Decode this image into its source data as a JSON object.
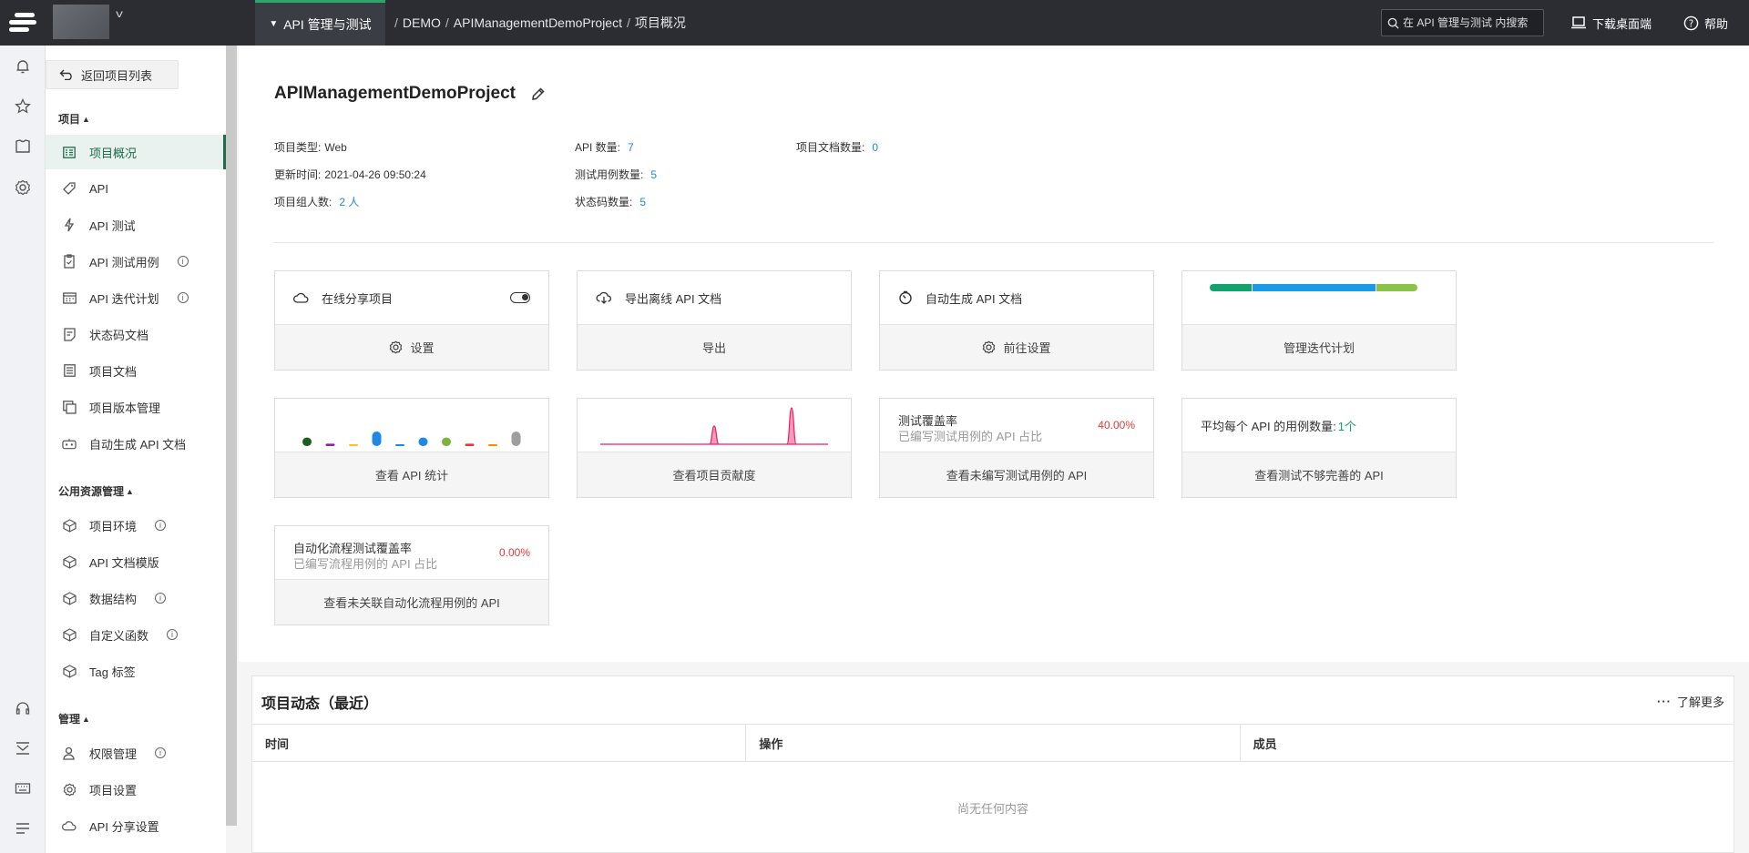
{
  "header": {
    "service_tab": "API 管理与测试",
    "breadcrumb": [
      "DEMO",
      "APIManagementDemoProject",
      "项目概况"
    ],
    "search_placeholder": "在 API 管理与测试 内搜索",
    "download_label": "下载桌面端",
    "help_label": "帮助"
  },
  "sidebar": {
    "back_label": "返回项目列表",
    "groups": [
      {
        "label": "项目",
        "items": [
          {
            "label": "项目概况",
            "icon": "overview-icon",
            "active": true,
            "info": false
          },
          {
            "label": "API",
            "icon": "api-tag-icon",
            "info": false
          },
          {
            "label": "API 测试",
            "icon": "lightning-icon",
            "info": false
          },
          {
            "label": "API 测试用例",
            "icon": "clipboard-icon",
            "info": true
          },
          {
            "label": "API 迭代计划",
            "icon": "calendar-icon",
            "info": true
          },
          {
            "label": "状态码文档",
            "icon": "status-doc-icon",
            "info": false
          },
          {
            "label": "项目文档",
            "icon": "doc-icon",
            "info": false
          },
          {
            "label": "项目版本管理",
            "icon": "versions-icon",
            "info": false
          },
          {
            "label": "自动生成 API 文档",
            "icon": "robot-icon",
            "info": false
          }
        ]
      },
      {
        "label": "公用资源管理",
        "items": [
          {
            "label": "项目环境",
            "icon": "cube-icon",
            "info": true
          },
          {
            "label": "API 文档模版",
            "icon": "cube-icon",
            "info": false
          },
          {
            "label": "数据结构",
            "icon": "cube-icon",
            "info": true
          },
          {
            "label": "自定义函数",
            "icon": "cube-icon",
            "info": true
          },
          {
            "label": "Tag 标签",
            "icon": "cube-icon",
            "info": false
          }
        ]
      },
      {
        "label": "管理",
        "items": [
          {
            "label": "权限管理",
            "icon": "user-lock-icon",
            "info": true
          },
          {
            "label": "项目设置",
            "icon": "gear-icon",
            "info": false
          },
          {
            "label": "API 分享设置",
            "icon": "cloud-icon",
            "info": false
          }
        ]
      }
    ]
  },
  "project": {
    "name": "APIManagementDemoProject",
    "type_label": "项目类型:",
    "type_value": "Web",
    "updated_label": "更新时间:",
    "updated_value": "2021-04-26 09:50:24",
    "members_label": "项目组人数:",
    "members_value": "2 人",
    "api_count_label": "API 数量:",
    "api_count_value": "7",
    "case_count_label": "测试用例数量:",
    "case_count_value": "5",
    "status_count_label": "状态码数量:",
    "status_count_value": "5",
    "doc_count_label": "项目文档数量:",
    "doc_count_value": "0"
  },
  "cards": {
    "share": {
      "title": "在线分享项目",
      "action": "设置"
    },
    "export": {
      "title": "导出离线 API 文档",
      "action": "导出"
    },
    "autogen": {
      "title": "自动生成 API 文档",
      "action": "前往设置"
    },
    "iteration": {
      "action": "管理迭代计划",
      "segments": [
        {
          "value": 20,
          "color": "#13a26b"
        },
        {
          "value": 60,
          "color": "#1b9ae8"
        },
        {
          "value": 20,
          "color": "#8bc34a"
        }
      ]
    },
    "api_stats": {
      "action": "查看 API 统计"
    },
    "contribution": {
      "action": "查看项目贡献度"
    },
    "test_coverage": {
      "title": "测试覆盖率",
      "subtitle": "已编写测试用例的 API 占比",
      "percent": "40.00%",
      "action": "查看未编写测试用例的 API"
    },
    "avg_cases": {
      "label": "平均每个 API 的用例数量:",
      "value": "1个",
      "action": "查看测试不够完善的 API"
    },
    "flow_coverage": {
      "title": "自动化流程测试覆盖率",
      "subtitle": "已编写流程用例的 API 占比",
      "percent": "0.00%",
      "action": "查看未关联自动化流程用例的 API"
    }
  },
  "chart_data": [
    {
      "type": "bar",
      "categories": [
        "",
        "",
        "",
        "",
        "",
        "",
        "",
        "",
        "",
        ""
      ],
      "values": [
        7,
        2,
        1,
        12,
        1,
        7,
        7,
        2,
        1,
        12
      ],
      "colors": [
        "#1b5e20",
        "#8e24aa",
        "#fbc02d",
        "#1e88e5",
        "#1e88e5",
        "#1e88e5",
        "#7cb342",
        "#e53935",
        "#fb8c00",
        "#9e9e9e"
      ]
    },
    {
      "type": "area",
      "x": [
        0,
        10,
        20,
        30,
        40,
        48,
        50,
        52,
        60,
        70,
        82,
        84,
        86,
        100
      ],
      "values": [
        0,
        0,
        0,
        0,
        0,
        0,
        1,
        0,
        0,
        0,
        0,
        2,
        0,
        0
      ],
      "color": "#e91e63"
    }
  ],
  "activity": {
    "title": "项目动态（最近）",
    "more_label": "了解更多",
    "columns": [
      "时间",
      "操作",
      "成员"
    ],
    "empty_text": "尚无任何内容"
  }
}
